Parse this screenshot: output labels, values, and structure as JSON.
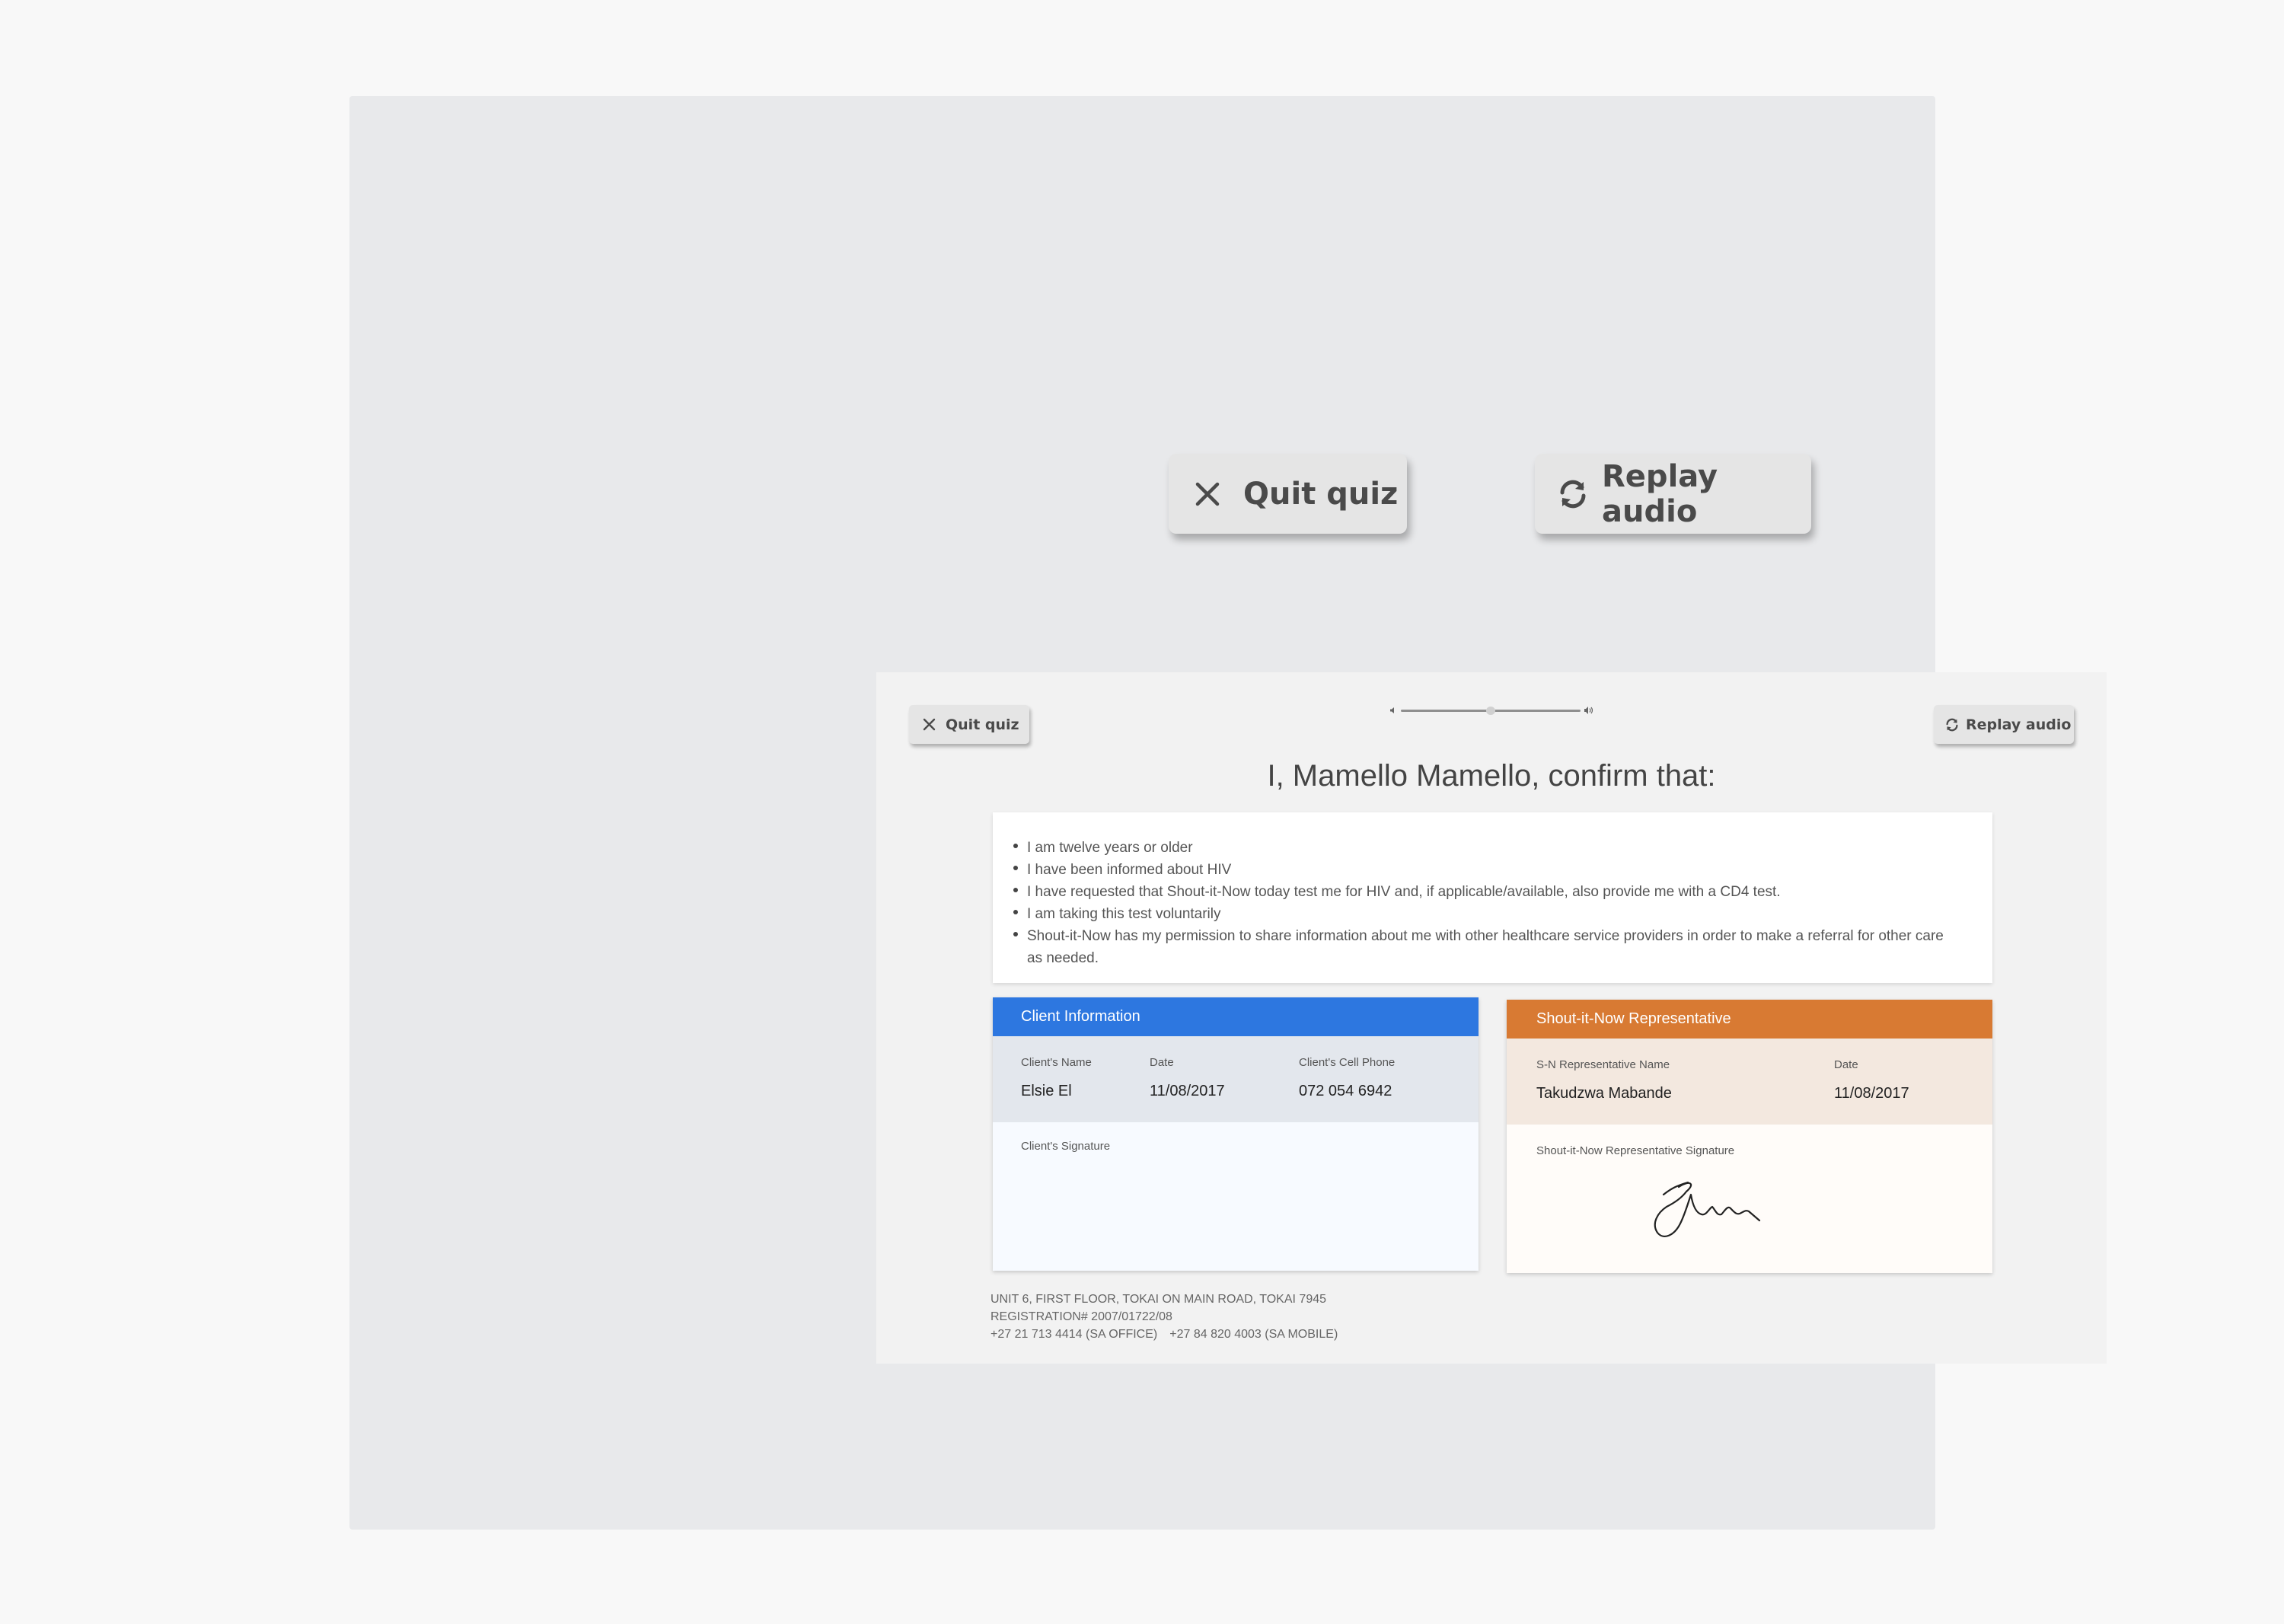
{
  "preview": {
    "quit_label": "Quit quiz",
    "replay_label": "Replay audio"
  },
  "screen": {
    "quit_label": "Quit quiz",
    "replay_label": "Replay audio",
    "audio": {
      "progress": 0.5
    },
    "title": "I, Mamello Mamello, confirm that:",
    "terms": [
      "I am twelve years or older",
      "I have been informed about HIV",
      "I have requested that Shout-it-Now today test me for HIV and, if applicable/available, also provide me with a CD4 test.",
      "I am taking this test voluntarily",
      "Shout-it-Now has my permission to share information about me with other healthcare service providers in order to make a referral for other care as needed."
    ],
    "client": {
      "header": "Client Information",
      "name_label": "Client's Name",
      "name": "Elsie El",
      "date_label": "Date",
      "date": "11/08/2017",
      "phone_label": "Client's Cell Phone",
      "phone": "072 054 6942",
      "signature_label": "Client's Signature"
    },
    "rep": {
      "header": "Shout-it-Now Representative",
      "name_label": "S-N Representative Name",
      "name": "Takudzwa Mabande",
      "date_label": "Date",
      "date": "11/08/2017",
      "signature_label": "Shout-it-Now Representative Signature"
    },
    "footer": {
      "address": "UNIT 6, FIRST FLOOR, TOKAI ON MAIN ROAD, TOKAI 7945",
      "registration": "REGISTRATION# 2007/01722/08",
      "office_phone": "+27 21 713 4414 (SA OFFICE)",
      "mobile_phone": "+27 84 820 4003 (SA MOBILE)"
    }
  },
  "colors": {
    "client_accent": "#2d77e0",
    "rep_accent": "#d87a33"
  },
  "icons": {
    "quit": "close-icon",
    "replay": "refresh-icon",
    "volume_low": "volume-low-icon",
    "volume_high": "volume-high-icon"
  }
}
